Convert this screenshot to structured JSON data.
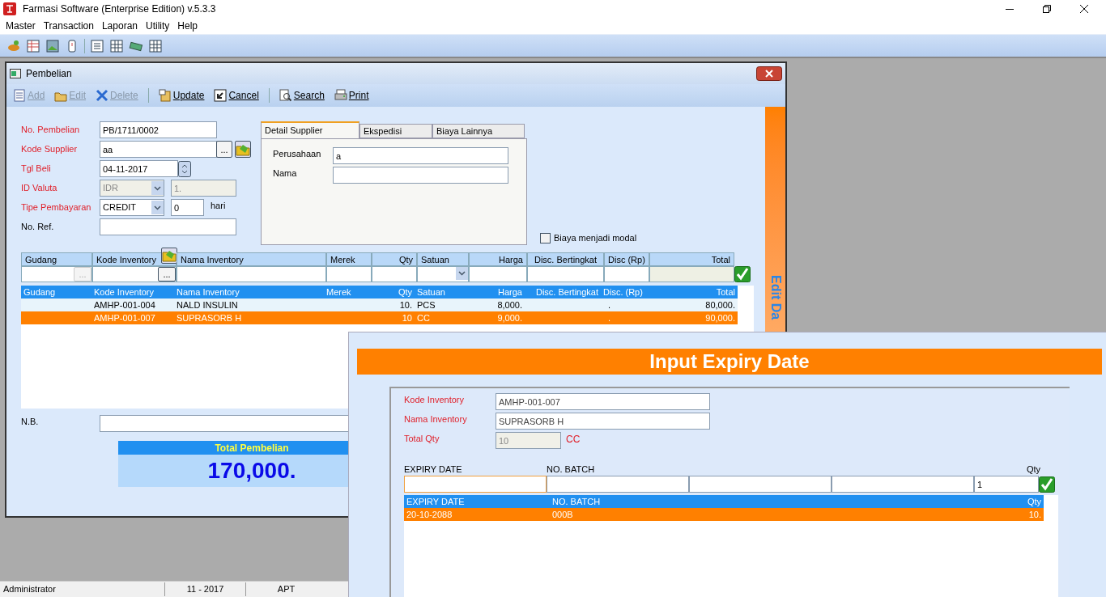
{
  "app": {
    "title": "Farmasi Software (Enterprise Edition) v.5.3.3",
    "menu": [
      "Master",
      "Transaction",
      "Laporan",
      "Utility",
      "Help"
    ]
  },
  "pembelian": {
    "title": "Pembelian",
    "toolbar": [
      {
        "label": "Add",
        "disabled": true
      },
      {
        "label": "Edit",
        "disabled": true
      },
      {
        "label": "Delete",
        "disabled": true
      },
      {
        "label": "Update",
        "disabled": false
      },
      {
        "label": "Cancel",
        "disabled": false
      },
      {
        "label": "Search",
        "disabled": false
      },
      {
        "label": "Print",
        "disabled": false
      }
    ],
    "fields": [
      {
        "label": "No. Pembelian",
        "required": true,
        "kind": "text",
        "value": "PB/1711/0002"
      },
      {
        "label": "Kode Supplier",
        "required": true,
        "kind": "lookup",
        "value": "aa",
        "button": "..."
      },
      {
        "label": "Tgl Beli",
        "required": true,
        "kind": "date",
        "value": "04-11-2017"
      },
      {
        "label": "ID Valuta",
        "required": true,
        "kind": "combo",
        "value": "IDR",
        "extra": "1.",
        "disabled": true
      },
      {
        "label": "Tipe Pembayaran",
        "required": true,
        "kind": "combo",
        "value": "CREDIT",
        "extra": "0",
        "suffix": "hari",
        "disabled": false
      },
      {
        "label": "No. Ref.",
        "required": false,
        "kind": "text"
      }
    ],
    "tabs": [
      {
        "label": "Detail Supplier",
        "selected": true
      },
      {
        "label": "Ekspedisi",
        "selected": false
      },
      {
        "label": "Biaya Lainnya",
        "selected": false
      }
    ],
    "tab_fields": [
      {
        "label": "Perusahaan",
        "value": "a"
      },
      {
        "label": "Nama"
      }
    ],
    "checkbox": {
      "label": "Biaya menjadi modal",
      "checked": false
    },
    "entry_columns": [
      {
        "label": "Gudang",
        "button": "...",
        "disabled": true
      },
      {
        "label": "Kode Inventory",
        "button": "...",
        "disabled": false
      },
      {
        "label": "Nama Inventory"
      },
      {
        "label": "Merek"
      },
      {
        "label": "Qty"
      },
      {
        "label": "Satuan"
      },
      {
        "label": "Harga"
      },
      {
        "label": "Disc. Bertingkat"
      },
      {
        "label": "Disc (Rp)"
      },
      {
        "label": "Total"
      }
    ],
    "grid": {
      "columns": [
        {
          "label": "Gudang"
        },
        {
          "label": "Kode Inventory"
        },
        {
          "label": "Nama Inventory"
        },
        {
          "label": "Merek"
        },
        {
          "label": "Qty"
        },
        {
          "label": "Satuan"
        },
        {
          "label": "Harga"
        },
        {
          "label": "Disc. Bertingkat"
        },
        {
          "label": "Disc. (Rp)"
        },
        {
          "label": "Total"
        }
      ],
      "rows": [
        {
          "cells": [
            "",
            "AMHP-001-004",
            "NALD INSULIN",
            "",
            "10.",
            "PCS",
            "8,000.",
            "",
            "  .",
            "80,000."
          ],
          "selected": false
        },
        {
          "cells": [
            "",
            "AMHP-001-007",
            "SUPRASORB H",
            "",
            "10",
            "CC",
            "9,000.",
            "",
            "  .",
            "90,000."
          ],
          "selected": true
        }
      ]
    },
    "nb_label": "N.B.",
    "total": {
      "label": "Total Pembelian",
      "value": "170,000."
    },
    "side_strip": "Edit Da"
  },
  "status_bar": [
    "Administrator",
    "11 - 2017",
    "APT"
  ],
  "dialog": {
    "title": "Input Expiry Date",
    "fields": [
      {
        "label": "Kode Inventory",
        "value": "AMHP-001-007",
        "disabled": false
      },
      {
        "label": "Nama Inventory",
        "value": "SUPRASORB H",
        "disabled": false
      },
      {
        "label": "Total Qty",
        "value": "10",
        "disabled": true,
        "unit": "CC"
      }
    ],
    "entry_headers": [
      "EXPIRY DATE",
      "NO. BATCH",
      "Qty"
    ],
    "entry_qty": "1",
    "grid": {
      "columns": [
        {
          "label": "EXPIRY DATE"
        },
        {
          "label": "NO. BATCH"
        },
        {
          "label": "Qty"
        }
      ],
      "rows": [
        {
          "cells": [
            "20-10-2088",
            "000B",
            "10."
          ],
          "selected": true
        }
      ]
    }
  }
}
